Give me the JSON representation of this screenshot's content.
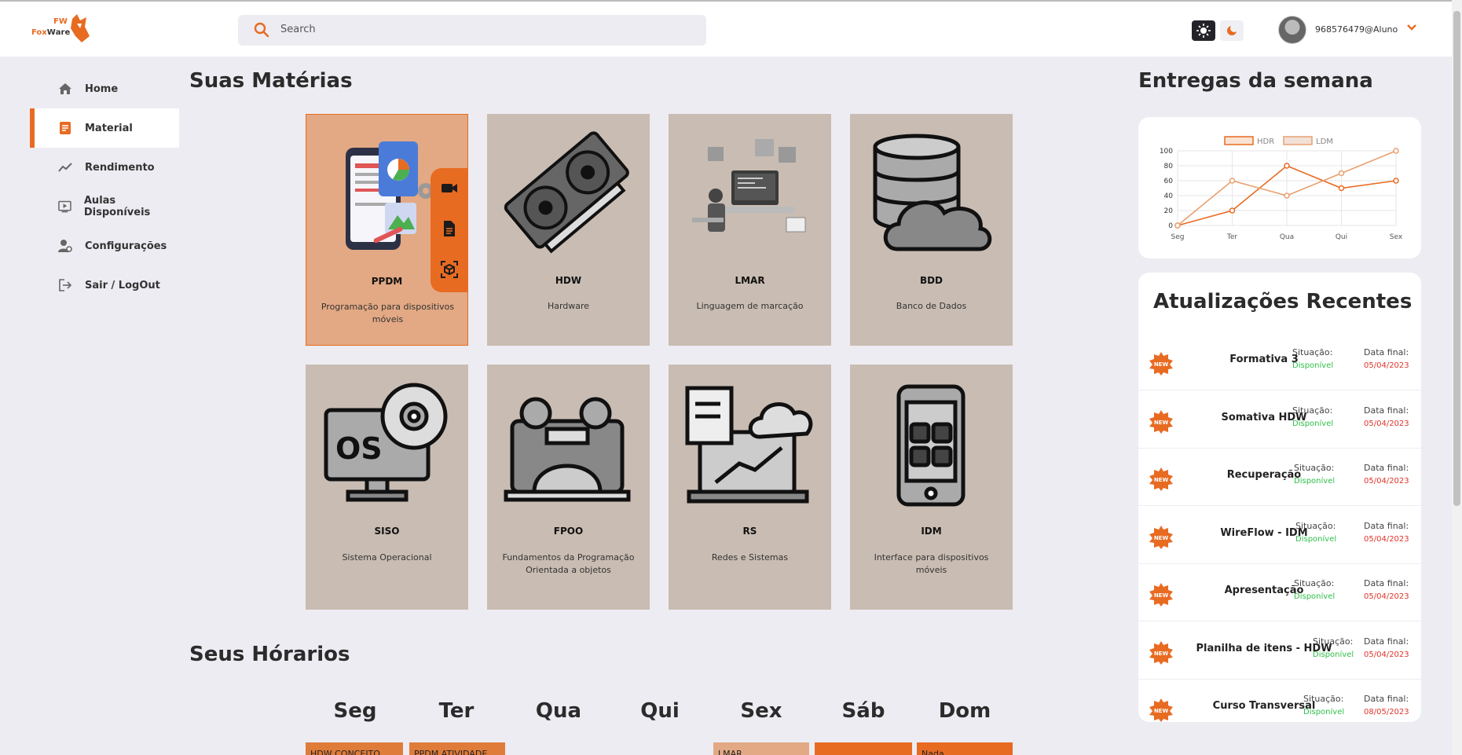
{
  "brand": {
    "top": "FW",
    "name_left": "Fox",
    "name_mid": "W",
    "name_right": "are"
  },
  "search": {
    "placeholder": "Search"
  },
  "user": {
    "name": "968576479@Aluno"
  },
  "sidebar": {
    "items": [
      {
        "label": "Home",
        "icon": "home-icon"
      },
      {
        "label": "Material",
        "icon": "document-icon",
        "active": true
      },
      {
        "label": "Rendimento",
        "icon": "trend-icon"
      },
      {
        "label": "Aulas Disponíveis",
        "icon": "video-icon"
      },
      {
        "label": "Configurações",
        "icon": "user-gear-icon"
      },
      {
        "label": "Sair / LogOut",
        "icon": "logout-icon"
      }
    ]
  },
  "subjects": {
    "title": "Suas Matérias",
    "cards": [
      {
        "code": "PPDM",
        "desc": "Programação para dispositivos móveis"
      },
      {
        "code": "HDW",
        "desc": "Hardware"
      },
      {
        "code": "LMAR",
        "desc": "Linguagem de marcação"
      },
      {
        "code": "BDD",
        "desc": "Banco de Dados"
      },
      {
        "code": "SISO",
        "desc": "Sistema Operacional"
      },
      {
        "code": "FPOO",
        "desc": "Fundamentos da Programação Orientada a objetos"
      },
      {
        "code": "RS",
        "desc": "Redes e Sistemas"
      },
      {
        "code": "IDM",
        "desc": "Interface para dispositivos móveis"
      }
    ]
  },
  "schedule": {
    "title": "Seus Hórarios",
    "days": [
      "Seg",
      "Ter",
      "Qua",
      "Qui",
      "Sex",
      "Sáb",
      "Dom"
    ],
    "slots": [
      "HDW CONCEITO",
      "PPDM ATIVIDADE",
      "LMAR",
      "",
      "Nada"
    ]
  },
  "deliveries": {
    "title": "Entregas da semana",
    "chart_data": {
      "type": "line",
      "categories": [
        "Seg",
        "Ter",
        "Qua",
        "Qui",
        "Sex"
      ],
      "series": [
        {
          "name": "HDR",
          "values": [
            0,
            20,
            80,
            50,
            60
          ],
          "color": "#e86b22"
        },
        {
          "name": "LDM",
          "values": [
            0,
            60,
            40,
            70,
            100
          ],
          "color": "#e8a070"
        }
      ],
      "yticks": [
        0,
        20,
        40,
        60,
        80,
        100
      ],
      "ylim": [
        0,
        100
      ],
      "legend": "top"
    }
  },
  "updates": {
    "title": "Atualizações Recentes",
    "badge": "NEW",
    "status_label": "Situação:",
    "date_label": "Data final:",
    "items": [
      {
        "title": "Formativa 3",
        "status": "Disponível",
        "date": "05/04/2023"
      },
      {
        "title": "Somativa HDW",
        "status": "Disponível",
        "date": "05/04/2023"
      },
      {
        "title": "Recuperação",
        "status": "Disponível",
        "date": "05/04/2023"
      },
      {
        "title": "WireFlow - IDM",
        "status": "Disponível",
        "date": "05/04/2023"
      },
      {
        "title": "Apresentação",
        "status": "Disponível",
        "date": "05/04/2023"
      },
      {
        "title": "Planilha de itens - HDW",
        "status": "Disponível",
        "date": "05/04/2023"
      },
      {
        "title": "Curso Transversal",
        "status": "Disponível",
        "date": "08/05/2023"
      }
    ]
  },
  "colors": {
    "accent": "#e86b22",
    "card": "#c9bcb2",
    "card_active": "#e3a984",
    "available": "#2fbf4a",
    "due": "#e0352b"
  }
}
